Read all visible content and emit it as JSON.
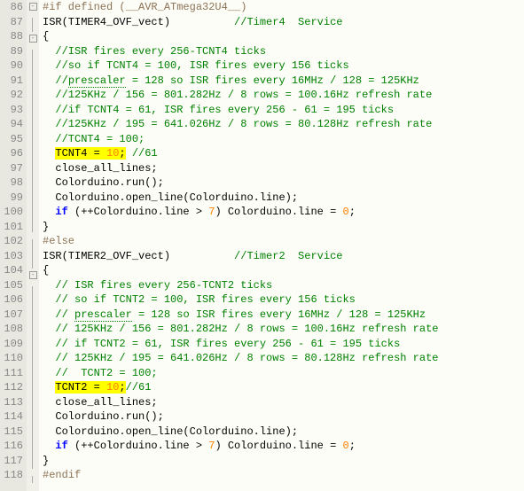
{
  "lines": [
    {
      "n": 86,
      "fold": "box",
      "html": "<span class='preproc'>#if defined (__AVR_ATmega32U4__)</span>"
    },
    {
      "n": 87,
      "fold": "line",
      "html": "<span class='normal'>ISR(TIMER4_OVF_vect)          </span><span class='comment'>//Timer4  Service</span>"
    },
    {
      "n": 88,
      "fold": "box",
      "html": "<span class='normal'>{</span>"
    },
    {
      "n": 89,
      "fold": "line",
      "html": "  <span class='comment'>//ISR fires every 256-TCNT4 ticks</span>"
    },
    {
      "n": 90,
      "fold": "line",
      "html": "  <span class='comment'>//so if TCNT4 = 100, ISR fires every 156 ticks</span>"
    },
    {
      "n": 91,
      "fold": "line",
      "html": "  <span class='comment'>//<span class='dotted'>prescaler</span> = 128 so ISR fires every 16MHz / 128 = 125KHz</span>"
    },
    {
      "n": 92,
      "fold": "line",
      "html": "  <span class='comment'>//125KHz / 156 = 801.282Hz / 8 rows = 100.16Hz refresh rate</span>"
    },
    {
      "n": 93,
      "fold": "line",
      "html": "  <span class='comment'>//if TCNT4 = 61, ISR fires every 256 - 61 = 195 ticks</span>"
    },
    {
      "n": 94,
      "fold": "line",
      "html": "  <span class='comment'>//125KHz / 195 = 641.026Hz / 8 rows = 80.128Hz refresh rate</span>"
    },
    {
      "n": 95,
      "fold": "line",
      "html": "  <span class='comment'>//TCNT4 = 100;</span>"
    },
    {
      "n": 96,
      "fold": "line",
      "html": "  <span class='hl'><span class='normal'>TCNT4 = </span><span class='number'>10</span><span class='normal'>;</span></span> <span class='comment'>//61</span>"
    },
    {
      "n": 97,
      "fold": "line",
      "html": "  <span class='normal'>close_all_lines;</span>"
    },
    {
      "n": 98,
      "fold": "line",
      "html": "  <span class='normal'>Colorduino.run();</span>"
    },
    {
      "n": 99,
      "fold": "line",
      "html": "  <span class='normal'>Colorduino.open_line(Colorduino.line);</span>"
    },
    {
      "n": 100,
      "fold": "line",
      "html": "  <span class='keyword'>if</span><span class='normal'> (++Colorduino.line &gt; </span><span class='number'>7</span><span class='normal'>) Colorduino.line = </span><span class='number'>0</span><span class='normal'>;</span>"
    },
    {
      "n": 101,
      "fold": "end",
      "html": "<span class='normal'>}</span>"
    },
    {
      "n": 102,
      "fold": "line",
      "html": "<span class='preproc'>#else</span>"
    },
    {
      "n": 103,
      "fold": "line",
      "html": "<span class='normal'>ISR(TIMER2_OVF_vect)          </span><span class='comment'>//Timer2  Service</span>"
    },
    {
      "n": 104,
      "fold": "box",
      "html": "<span class='normal'>{</span>"
    },
    {
      "n": 105,
      "fold": "line",
      "html": "  <span class='comment'>// ISR fires every 256-TCNT2 ticks</span>"
    },
    {
      "n": 106,
      "fold": "line",
      "html": "  <span class='comment'>// so if TCNT2 = 100, ISR fires every 156 ticks</span>"
    },
    {
      "n": 107,
      "fold": "line",
      "html": "  <span class='comment'>// <span class='dotted'>prescaler</span> = 128 so ISR fires every 16MHz / 128 = 125KHz</span>"
    },
    {
      "n": 108,
      "fold": "line",
      "html": "  <span class='comment'>// 125KHz / 156 = 801.282Hz / 8 rows = 100.16Hz refresh rate</span>"
    },
    {
      "n": 109,
      "fold": "line",
      "html": "  <span class='comment'>// if TCNT2 = 61, ISR fires every 256 - 61 = 195 ticks</span>"
    },
    {
      "n": 110,
      "fold": "line",
      "html": "  <span class='comment'>// 125KHz / 195 = 641.026Hz / 8 rows = 80.128Hz refresh rate</span>"
    },
    {
      "n": 111,
      "fold": "line",
      "html": "  <span class='comment'>//  TCNT2 = 100;</span>"
    },
    {
      "n": 112,
      "fold": "line",
      "html": "  <span class='hl'><span class='normal'>TCNT2 = </span><span class='number'>10</span><span class='normal'>;</span></span><span class='comment'>//61</span>"
    },
    {
      "n": 113,
      "fold": "line",
      "html": "  <span class='normal'>close_all_lines;</span>"
    },
    {
      "n": 114,
      "fold": "line",
      "html": "  <span class='normal'>Colorduino.run();</span>"
    },
    {
      "n": 115,
      "fold": "line",
      "html": "  <span class='normal'>Colorduino.open_line(Colorduino.line);</span>"
    },
    {
      "n": 116,
      "fold": "line",
      "html": "  <span class='keyword'>if</span><span class='normal'> (++Colorduino.line &gt; </span><span class='number'>7</span><span class='normal'>) Colorduino.line = </span><span class='number'>0</span><span class='normal'>;</span>"
    },
    {
      "n": 117,
      "fold": "end",
      "html": "<span class='normal'>}</span>"
    },
    {
      "n": 118,
      "fold": "end",
      "html": "<span class='preproc'>#endif</span>"
    }
  ]
}
